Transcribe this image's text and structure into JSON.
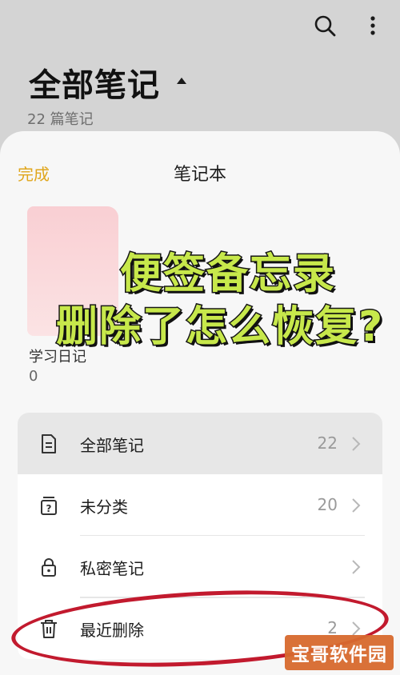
{
  "header": {
    "title": "全部笔记",
    "subtitle": "22 篇笔记",
    "icons": [
      "search-icon",
      "more-vertical-icon",
      "caret-up-icon"
    ]
  },
  "sheet": {
    "done_label": "完成",
    "title": "笔记本",
    "notebook": {
      "name": "学习日记",
      "count": "0",
      "cover_color": "#f9cfd3"
    },
    "menu": [
      {
        "icon": "document-icon",
        "label": "全部笔记",
        "count": "22",
        "active": true
      },
      {
        "icon": "uncategorized-icon",
        "label": "未分类",
        "count": "20",
        "active": false
      },
      {
        "icon": "lock-icon",
        "label": "私密笔记",
        "count": "",
        "active": false
      },
      {
        "icon": "trash-icon",
        "label": "最近删除",
        "count": "2",
        "active": false
      }
    ]
  },
  "overlay": {
    "line1": "便签备忘录",
    "line2": "删除了怎么恢复?",
    "text_color": "#c7e84b"
  },
  "watermark": {
    "text": "宝哥软件园",
    "color": "#d86a2e"
  },
  "colors": {
    "accent": "#e0a61c",
    "highlight": "#c21a2e",
    "background": "#d4d4d4"
  }
}
